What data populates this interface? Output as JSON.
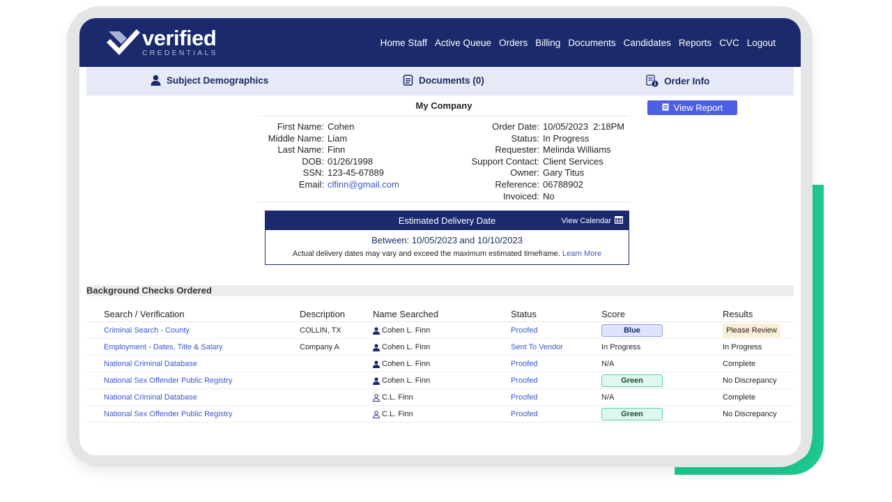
{
  "brand": {
    "word": "verified",
    "sub": "CREDENTIALS",
    "colors": {
      "navy": "#1a2a6c",
      "accent_green": "#1fc991",
      "link": "#3b55c9",
      "button": "#4d5fe3"
    }
  },
  "nav": [
    "Home Staff",
    "Active Queue",
    "Orders",
    "Billing",
    "Documents",
    "Candidates",
    "Reports",
    "CVC",
    "Logout"
  ],
  "subnav": {
    "demographics": {
      "label": "Subject Demographics",
      "icon": "person-icon"
    },
    "documents": {
      "label": "Documents (0)",
      "icon": "document-icon"
    },
    "order_info": {
      "label": "Order Info",
      "icon": "order-info-icon"
    }
  },
  "company": "My Company",
  "view_report": "View Report",
  "subject": [
    {
      "label": "First Name:",
      "value": "Cohen"
    },
    {
      "label": "Middle Name:",
      "value": "Liam"
    },
    {
      "label": "Last Name:",
      "value": "Finn"
    },
    {
      "label": "DOB:",
      "value": "01/26/1998"
    },
    {
      "label": "SSN:",
      "value": "123-45-67889"
    },
    {
      "label": "Email:",
      "value": "clfinn@gmail.com"
    }
  ],
  "order": [
    {
      "label": "Order Date:",
      "value": "10/05/2023  2:18PM"
    },
    {
      "label": "Status:",
      "value": "In Progress"
    },
    {
      "label": "Requester:",
      "value": "Melinda Williams"
    },
    {
      "label": "Support Contact:",
      "value": "Client Services"
    },
    {
      "label": "Owner:",
      "value": "Gary Titus"
    },
    {
      "label": "Reference:",
      "value": "06788902"
    },
    {
      "label": "Invoiced:",
      "value": "No"
    }
  ],
  "delivery": {
    "title": "Estimated Delivery Date",
    "calendar_label": "View Calendar",
    "range": "Between: 10/05/2023 and 10/10/2023",
    "note": "Actual delivery dates may vary and exceed the maximum estimated timeframe.",
    "learn_more": "Learn More"
  },
  "checks": {
    "title": "Background Checks Ordered",
    "headers": [
      "Search / Verification",
      "Description",
      "Name Searched",
      "Status",
      "Score",
      "Results"
    ],
    "rows": [
      {
        "search": "Criminal Search - County",
        "description": "COLLIN, TX",
        "name": "Cohen L. Finn",
        "person_icon": "person-solid-icon",
        "status": "Proofed",
        "score": "Blue",
        "score_style": "blue",
        "results": "Please Review",
        "results_flag": true
      },
      {
        "search": "Employment - Dates, Title & Salary",
        "description": "Company A",
        "name": "Cohen L. Finn",
        "person_icon": "person-solid-icon",
        "status": "Sent To Vendor",
        "score": "In Progress",
        "score_style": "text",
        "results": "In Progress",
        "results_flag": false
      },
      {
        "search": "National Criminal Database",
        "description": "",
        "name": "Cohen L. Finn",
        "person_icon": "person-solid-icon",
        "status": "Proofed",
        "score": "N/A",
        "score_style": "text",
        "results": "Complete",
        "results_flag": false
      },
      {
        "search": "National Sex Offender Public Registry",
        "description": "",
        "name": "Cohen L. Finn",
        "person_icon": "person-solid-icon",
        "status": "Proofed",
        "score": "Green",
        "score_style": "green",
        "results": "No Discrepancy",
        "results_flag": false
      },
      {
        "search": "National Criminal Database",
        "description": "",
        "name": "C.L. Finn",
        "person_icon": "person-outline-icon",
        "status": "Proofed",
        "score": "N/A",
        "score_style": "text",
        "results": "Complete",
        "results_flag": false
      },
      {
        "search": "National Sex Offender Public Registry",
        "description": "",
        "name": "C.L. Finn",
        "person_icon": "person-outline-icon",
        "status": "Proofed",
        "score": "Green",
        "score_style": "green",
        "results": "No Discrepancy",
        "results_flag": false
      }
    ]
  }
}
